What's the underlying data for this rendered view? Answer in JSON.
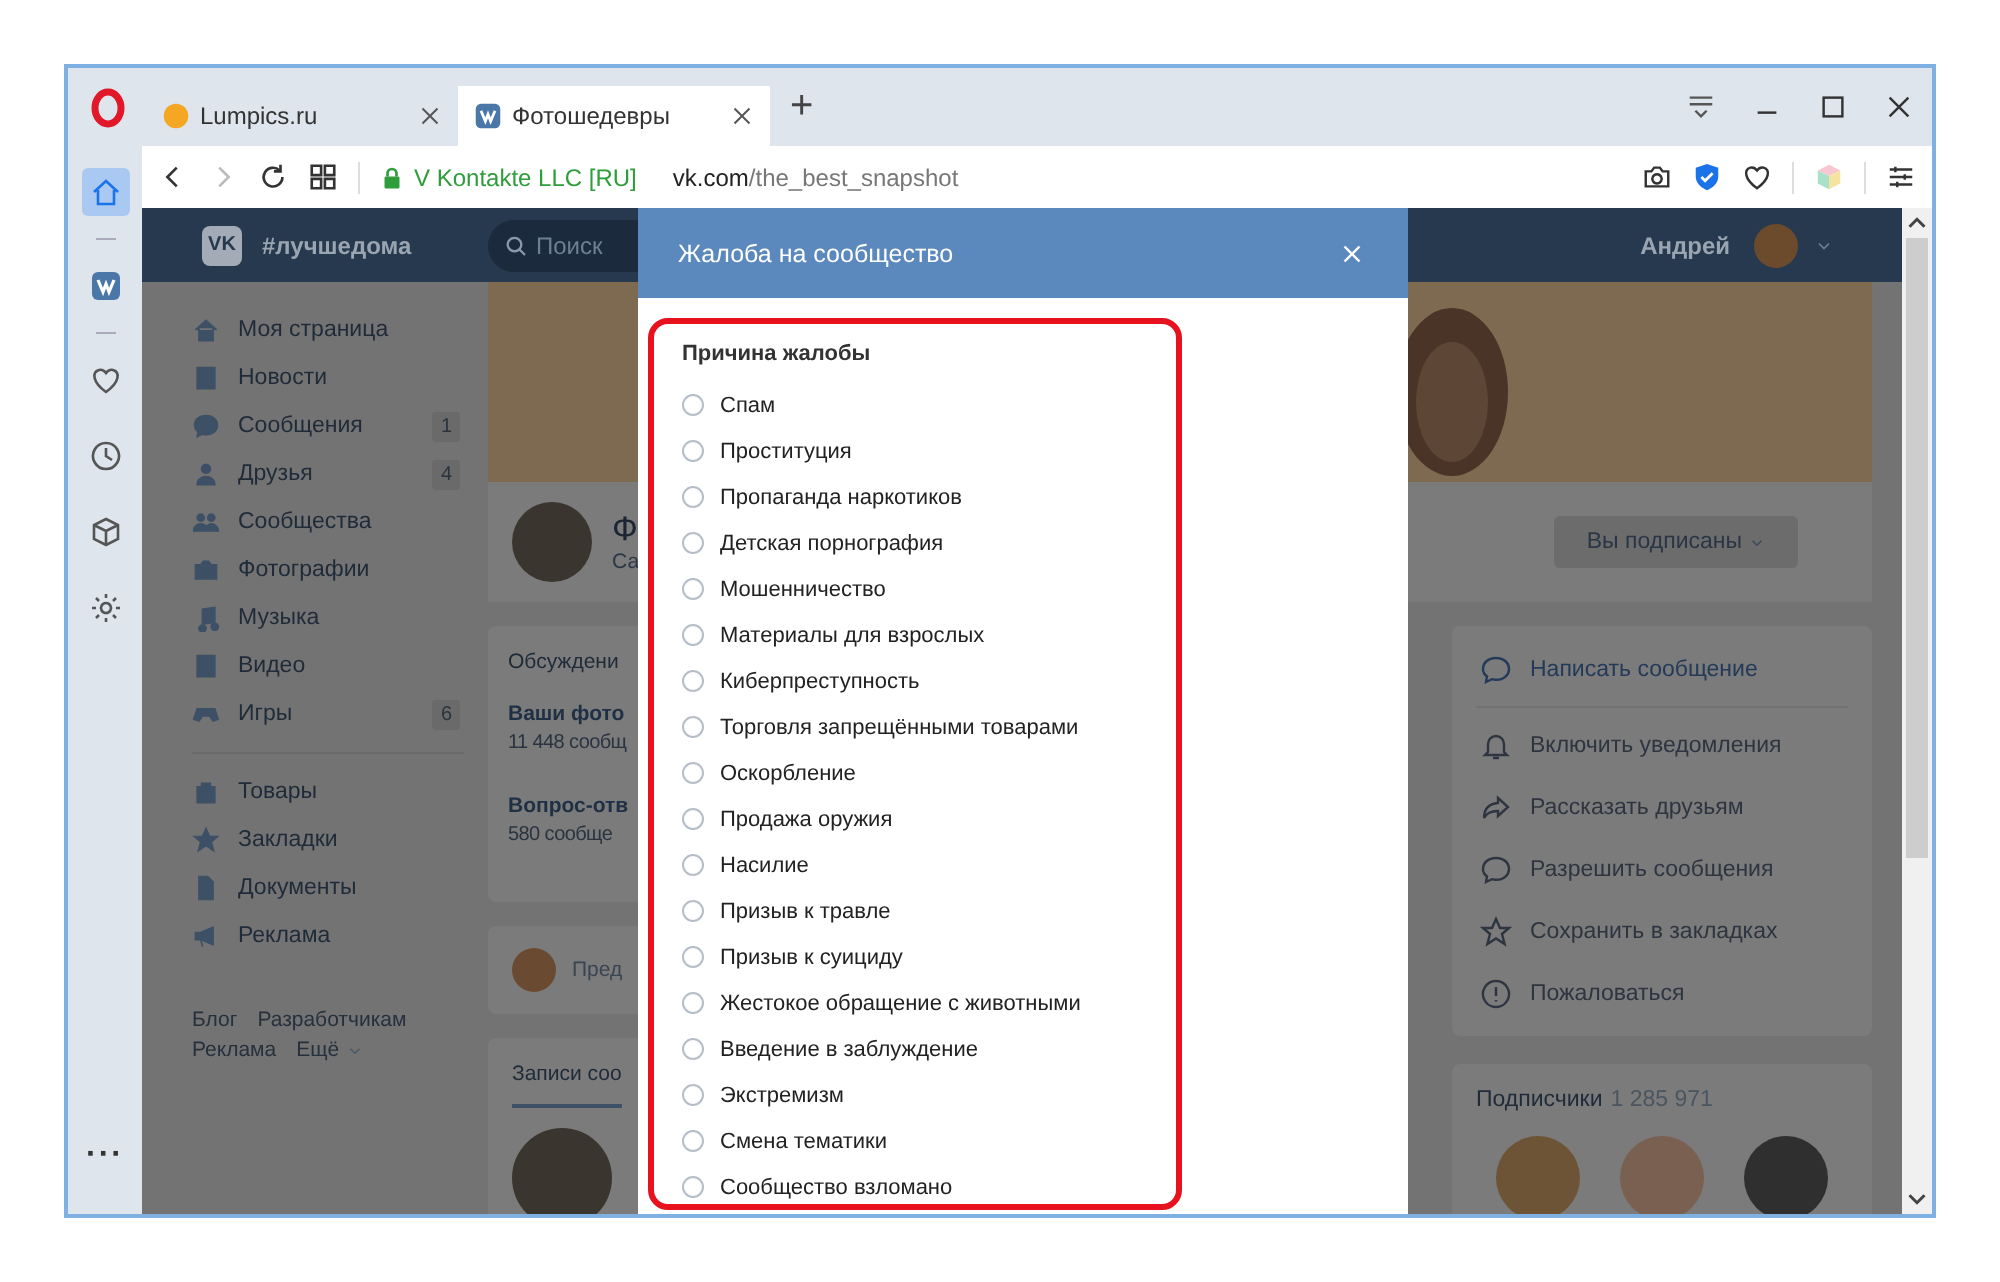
{
  "browser": {
    "tabs": [
      {
        "title": "Lumpics.ru",
        "kind": "site",
        "selected": false
      },
      {
        "title": "Фотошедевры",
        "kind": "vk",
        "selected": true
      }
    ],
    "new_tab": "+",
    "toolbar": [
      {
        "kind": "back",
        "disabled": false
      },
      {
        "kind": "forward",
        "disabled": true
      },
      {
        "kind": "reload",
        "disabled": false
      },
      {
        "kind": "grid",
        "disabled": false
      }
    ],
    "security": "V Kontakte LLC [RU]",
    "url_host": "vk.com",
    "url_path": "/the_best_snapshot"
  },
  "opera_sidebar": {
    "items": [
      {
        "kind": "home",
        "selected": true
      },
      {
        "kind": "vk",
        "selected": false
      },
      {
        "kind": "heart",
        "selected": false
      },
      {
        "kind": "clock",
        "selected": false
      },
      {
        "kind": "cube",
        "selected": false
      },
      {
        "kind": "gear",
        "selected": false
      }
    ],
    "more": "···"
  },
  "vk_header": {
    "logo": "VK",
    "community": "#лучшедома",
    "search_placeholder": "Поиск",
    "user": "Андрей"
  },
  "left_menu": {
    "items": [
      {
        "kind": "home",
        "label": "Моя страница"
      },
      {
        "kind": "news",
        "label": "Новости"
      },
      {
        "kind": "message",
        "label": "Сообщения",
        "count": "1"
      },
      {
        "kind": "person",
        "label": "Друзья",
        "count": "4"
      },
      {
        "kind": "people",
        "label": "Сообщества"
      },
      {
        "kind": "camera",
        "label": "Фотографии"
      },
      {
        "kind": "music",
        "label": "Музыка"
      },
      {
        "kind": "film",
        "label": "Видео"
      },
      {
        "kind": "gamepad",
        "label": "Игры",
        "count": "6"
      }
    ],
    "extra_items": [
      {
        "kind": "bag",
        "label": "Товары"
      },
      {
        "kind": "star",
        "label": "Закладки"
      },
      {
        "kind": "doc",
        "label": "Документы"
      },
      {
        "kind": "megaphone",
        "label": "Реклама"
      }
    ],
    "footer_links": [
      "Блог",
      "Разработчикам",
      "Реклама",
      "Ещё"
    ]
  },
  "profile": {
    "name": "Ф",
    "subtitle": "Са",
    "subscribe_button": "Вы подписаны"
  },
  "discussions": {
    "title": "Обсуждени",
    "topics": [
      {
        "title": "Ваши фото",
        "count": "11 448 сообщ"
      },
      {
        "title": "Вопрос-отв",
        "count": "580 сообще"
      }
    ]
  },
  "composer": {
    "placeholder": "Пред"
  },
  "posts": {
    "tab": "Записи соо"
  },
  "actions": [
    {
      "kind": "message",
      "label": "Написать сообщение",
      "primary": true
    },
    {
      "kind": "bell",
      "label": "Включить уведомления",
      "primary": false
    },
    {
      "kind": "share",
      "label": "Рассказать друзьям",
      "primary": false
    },
    {
      "kind": "message",
      "label": "Разрешить сообщения",
      "primary": false
    },
    {
      "kind": "star",
      "label": "Сохранить в закладках",
      "primary": false
    },
    {
      "kind": "warning",
      "label": "Пожаловаться",
      "primary": false
    }
  ],
  "subscribers": {
    "title": "Подписчики",
    "count": "1 285 971"
  },
  "dialog": {
    "title": "Жалоба на сообщество",
    "section_title": "Причина жалобы",
    "reasons": [
      {
        "label": "Спам",
        "selected": false
      },
      {
        "label": "Проституция",
        "selected": false
      },
      {
        "label": "Пропаганда наркотиков",
        "selected": false
      },
      {
        "label": "Детская порнография",
        "selected": false
      },
      {
        "label": "Мошенничество",
        "selected": false
      },
      {
        "label": "Материалы для взрослых",
        "selected": false
      },
      {
        "label": "Киберпреступность",
        "selected": false
      },
      {
        "label": "Торговля запрещёнными товарами",
        "selected": false
      },
      {
        "label": "Оскорбление",
        "selected": false
      },
      {
        "label": "Продажа оружия",
        "selected": false
      },
      {
        "label": "Насилие",
        "selected": false
      },
      {
        "label": "Призыв к травле",
        "selected": false
      },
      {
        "label": "Призыв к суициду",
        "selected": false
      },
      {
        "label": "Жестокое обращение с животными",
        "selected": false
      },
      {
        "label": "Введение в заблуждение",
        "selected": false
      },
      {
        "label": "Экстремизм",
        "selected": false
      },
      {
        "label": "Смена тематики",
        "selected": false
      },
      {
        "label": "Сообщество взломано",
        "selected": false
      }
    ]
  }
}
